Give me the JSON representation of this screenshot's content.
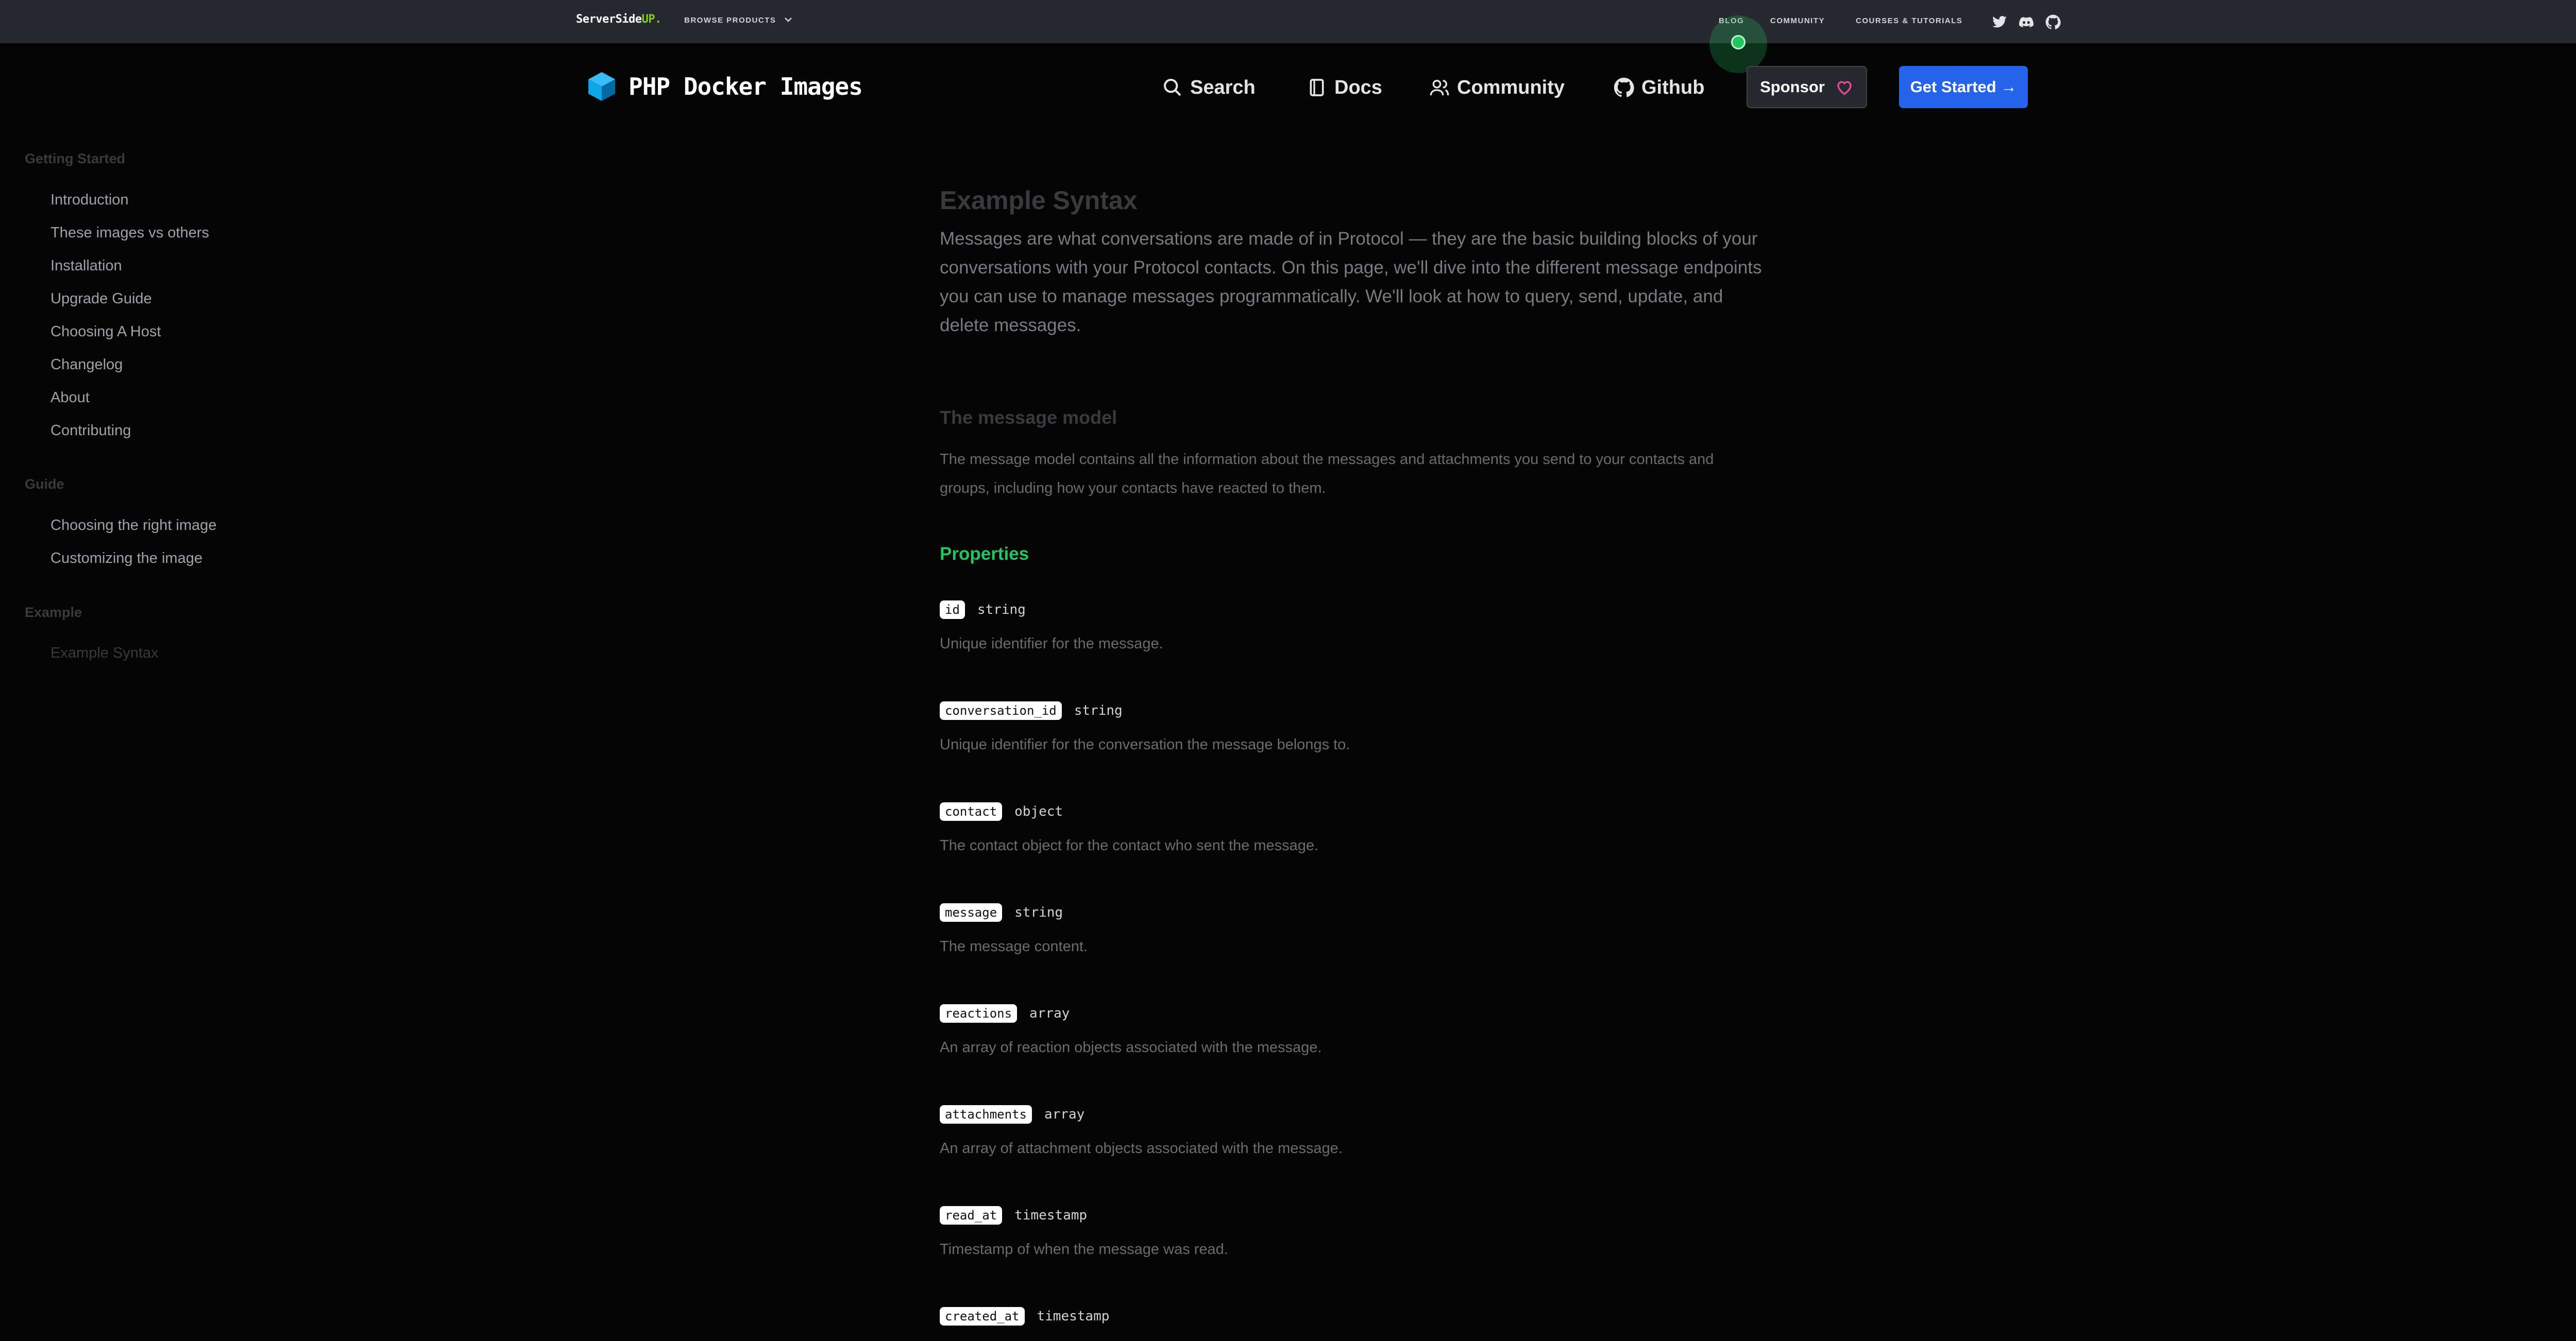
{
  "topbar": {
    "brand_main": "ServerSide",
    "brand_up": "UP.",
    "browse_label": "BROWSE PRODUCTS",
    "links": [
      "BLOG",
      "COMMUNITY",
      "COURSES & TUTORIALS"
    ],
    "social_icons": [
      "twitter-icon",
      "discord-icon",
      "github-icon"
    ]
  },
  "header": {
    "site_title": "PHP Docker Images",
    "nav": {
      "search": "Search",
      "docs": "Docs",
      "community": "Community",
      "github": "Github"
    },
    "sponsor_label": "Sponsor",
    "get_started_label": "Get Started →"
  },
  "sidebar": {
    "sections": [
      {
        "title": "Getting Started",
        "items": [
          "Introduction",
          "These images vs others",
          "Installation",
          "Upgrade Guide",
          "Choosing A Host",
          "Changelog",
          "About",
          "Contributing"
        ]
      },
      {
        "title": "Guide",
        "items": [
          "Choosing the right image",
          "Customizing the image"
        ]
      },
      {
        "title": "Example",
        "items": [
          "Example Syntax"
        ]
      }
    ]
  },
  "main": {
    "title": "Example Syntax",
    "lead": "Messages are what conversations are made of in Protocol — they are the basic building blocks of your conversations with your Protocol contacts. On this page, we'll dive into the different message endpoints you can use to manage messages programmatically. We'll look at how to query, send, update, and delete messages.",
    "section_title": "The message model",
    "section_text": "The message model contains all the information about the messages and attachments you send to your contacts and groups, including how your contacts have reacted to them.",
    "properties_title": "Properties",
    "properties": [
      {
        "name": "id",
        "type": "string",
        "desc": "Unique identifier for the message."
      },
      {
        "name": "conversation_id",
        "type": "string",
        "desc": "Unique identifier for the conversation the message belongs to."
      },
      {
        "name": "contact",
        "type": "object",
        "desc": "The contact object for the contact who sent the message."
      },
      {
        "name": "message",
        "type": "string",
        "desc": "The message content."
      },
      {
        "name": "reactions",
        "type": "array",
        "desc": "An array of reaction objects associated with the message."
      },
      {
        "name": "attachments",
        "type": "array",
        "desc": "An array of attachment objects associated with the message."
      },
      {
        "name": "read_at",
        "type": "timestamp",
        "desc": "Timestamp of when the message was read."
      },
      {
        "name": "created_at",
        "type": "timestamp",
        "desc": ""
      }
    ]
  },
  "colors": {
    "accent_green": "#22c55e",
    "primary_blue": "#2563eb",
    "topbar_bg": "#262a30"
  }
}
